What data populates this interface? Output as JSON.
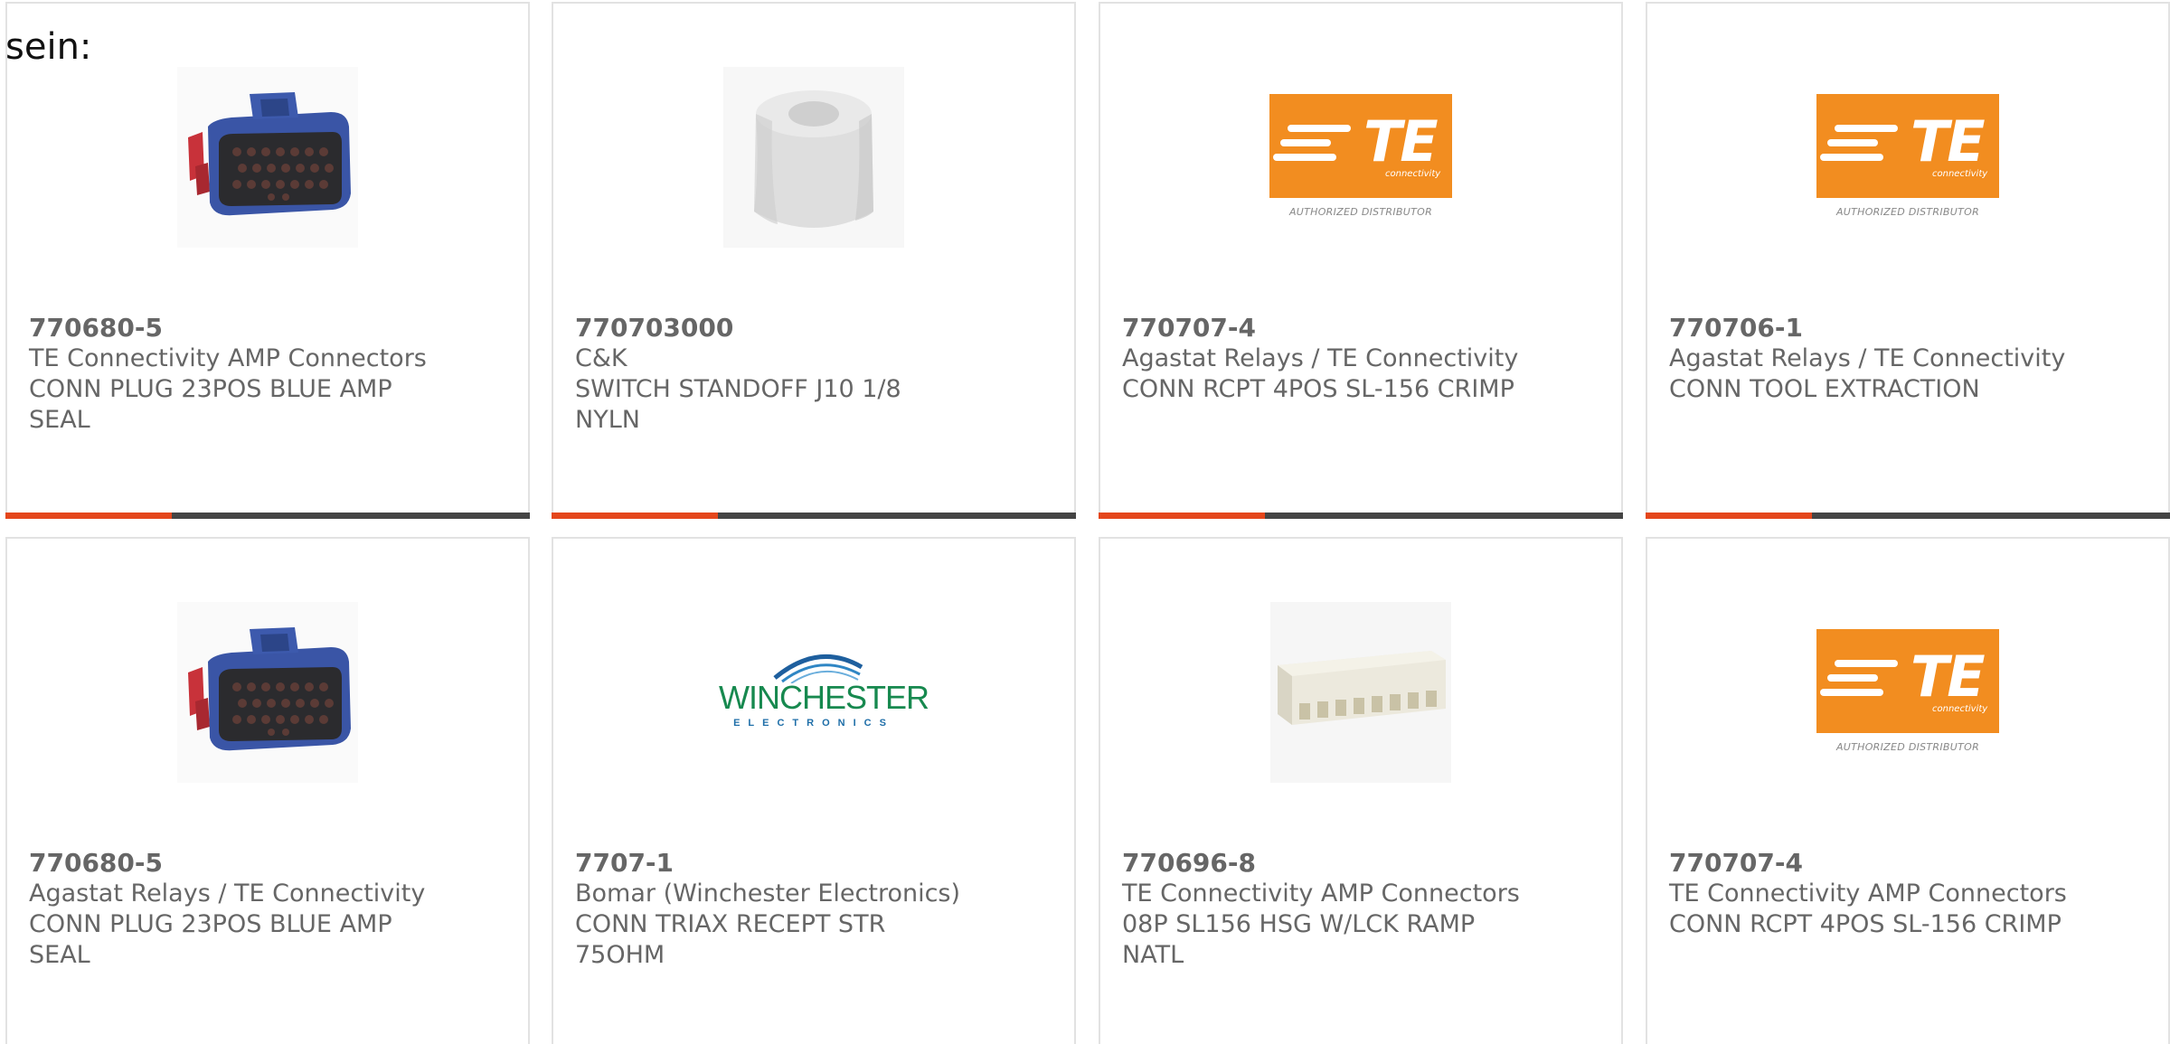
{
  "lead_text": "sein:",
  "colors": {
    "accent_bar": "#e4461b",
    "bar_dark": "#444444",
    "te_orange": "#f28d20",
    "winchester_green": "#17894f"
  },
  "cards": [
    {
      "part_number": "770680-5",
      "manufacturer": "TE Connectivity AMP Connectors",
      "desc1": "CONN PLUG 23POS BLUE AMP",
      "desc2": "SEAL",
      "image": "blue-connector-plug-icon"
    },
    {
      "part_number": "770703000",
      "manufacturer": "C&K",
      "desc1": "SWITCH STANDOFF J10 1/8",
      "desc2": "NYLN",
      "image": "nylon-standoff-icon"
    },
    {
      "part_number": "770707-4",
      "manufacturer": "Agastat Relays / TE Connectivity",
      "desc1": "CONN RCPT 4POS SL-156 CRIMP",
      "desc2": "",
      "image": "te-connectivity-logo"
    },
    {
      "part_number": "770706-1",
      "manufacturer": "Agastat Relays / TE Connectivity",
      "desc1": "CONN TOOL EXTRACTION",
      "desc2": "",
      "image": "te-connectivity-logo"
    },
    {
      "part_number": "770680-5",
      "manufacturer": "Agastat Relays / TE Connectivity",
      "desc1": "CONN PLUG 23POS BLUE AMP",
      "desc2": "SEAL",
      "image": "blue-connector-plug-icon"
    },
    {
      "part_number": "7707-1",
      "manufacturer": "Bomar (Winchester Electronics)",
      "desc1": "CONN TRIAX RECEPT STR",
      "desc2": "75OHM",
      "image": "winchester-electronics-logo"
    },
    {
      "part_number": "770696-8",
      "manufacturer": "TE Connectivity AMP Connectors",
      "desc1": "08P SL156 HSG W/LCK RAMP",
      "desc2": "NATL",
      "image": "white-housing-connector-icon"
    },
    {
      "part_number": "770707-4",
      "manufacturer": "TE Connectivity AMP Connectors",
      "desc1": "CONN RCPT 4POS SL-156 CRIMP",
      "desc2": "",
      "image": "te-connectivity-logo"
    }
  ],
  "te_logo": {
    "text": "TE",
    "sub": "connectivity",
    "caption": "AUTHORIZED DISTRIBUTOR"
  },
  "winchester_logo": {
    "name": "WINCHESTER",
    "sub": "ELECTRONICS"
  }
}
